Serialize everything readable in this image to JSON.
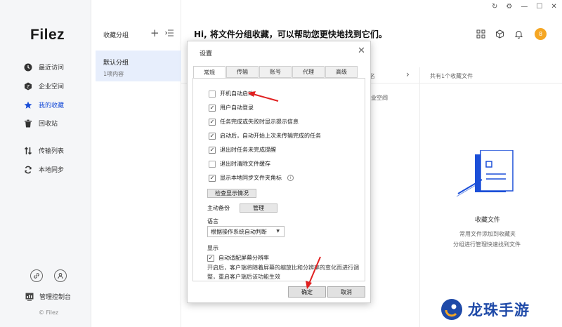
{
  "app": {
    "logo": "Filez",
    "copyright": "© Filez"
  },
  "sidebar": {
    "items": [
      {
        "label": "最近访问",
        "icon": "clock-icon"
      },
      {
        "label": "企业空间",
        "icon": "enterprise-icon"
      },
      {
        "label": "我的收藏",
        "icon": "star-icon",
        "active": true
      },
      {
        "label": "回收站",
        "icon": "trash-icon"
      },
      {
        "label": "传输列表",
        "icon": "transfer-icon"
      },
      {
        "label": "本地同步",
        "icon": "sync-icon"
      }
    ],
    "admin_label": "管理控制台"
  },
  "groups": {
    "title": "收藏分组",
    "plus": "+",
    "selected": {
      "name": "默认分组",
      "count": "1项内容"
    }
  },
  "main": {
    "greeting": "Hi, 将文件分组收藏，可以帮助您更快地找到它们。",
    "partial_col": "名",
    "partial_row": "企业空间",
    "fav_count": "共有1个收藏文件",
    "empty_title": "收藏文件",
    "empty_line1": "常用文件添加到收藏夹",
    "empty_line2": "分组进行管理快速找到文件",
    "avatar": "8"
  },
  "dialog": {
    "title": "设置",
    "close": "✕",
    "tabs": [
      "常规",
      "传输",
      "账号",
      "代理",
      "高级"
    ],
    "options": [
      {
        "label": "开机自动启动",
        "checked": false
      },
      {
        "label": "用户自动登录",
        "checked": true
      },
      {
        "label": "任务完成或失败时显示提示信息",
        "checked": true
      },
      {
        "label": "启动后，自动开始上次未传输完成的任务",
        "checked": true
      },
      {
        "label": "退出时任务未完成提醒",
        "checked": true
      },
      {
        "label": "退出时清除文件缓存",
        "checked": false
      },
      {
        "label": "显示本地同步文件夹角标",
        "checked": true
      }
    ],
    "check_btn": "检查显示情况",
    "backup_label": "主动备份",
    "manage_btn": "管理",
    "language_label": "语言",
    "language_value": "根据操作系统自动判断",
    "display_label": "显示",
    "adapt_label": "自动适配屏幕分辨率",
    "adapt_checked": true,
    "adapt_desc": "开启后，客户端将随着屏幕的缩放比和分辨率的变化而进行调整，重启客户端后该功能生效",
    "ok": "确定",
    "cancel": "取消"
  },
  "watermark": {
    "text": "龙珠手游"
  },
  "colors": {
    "accent": "#1b4fd8",
    "selected_bg": "#e7eefc",
    "avatar": "#f5a623",
    "arrow": "#e02020"
  }
}
